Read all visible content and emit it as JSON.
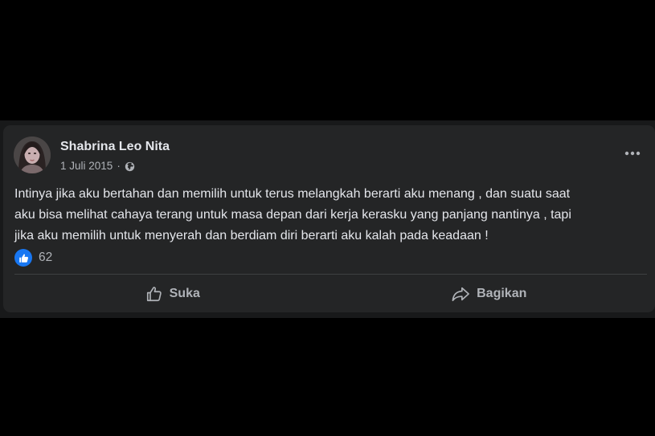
{
  "post": {
    "author": "Shabrina Leo Nita",
    "date": "1 Juli 2015",
    "separator": "·",
    "privacy_icon": "globe-icon",
    "text": "Intinya jika aku bertahan dan memilih untuk terus melangkah berarti aku menang , dan suatu saat\naku bisa melihat cahaya terang untuk masa depan dari kerja kerasku yang panjang nantinya ,  tapi\njika aku memilih untuk menyerah dan berdiam diri berarti aku kalah pada keadaan !",
    "reaction_icon": "like-icon",
    "reaction_count": "62",
    "more_icon": "more-options-icon"
  },
  "actions": {
    "like_label": "Suka",
    "share_label": "Bagikan"
  },
  "colors": {
    "page_background": "#000000",
    "card_background": "#242526",
    "primary_text": "#e4e6eb",
    "secondary_text": "#b0b3b8",
    "like_blue": "#1877f2",
    "divider": "#3e4042"
  }
}
